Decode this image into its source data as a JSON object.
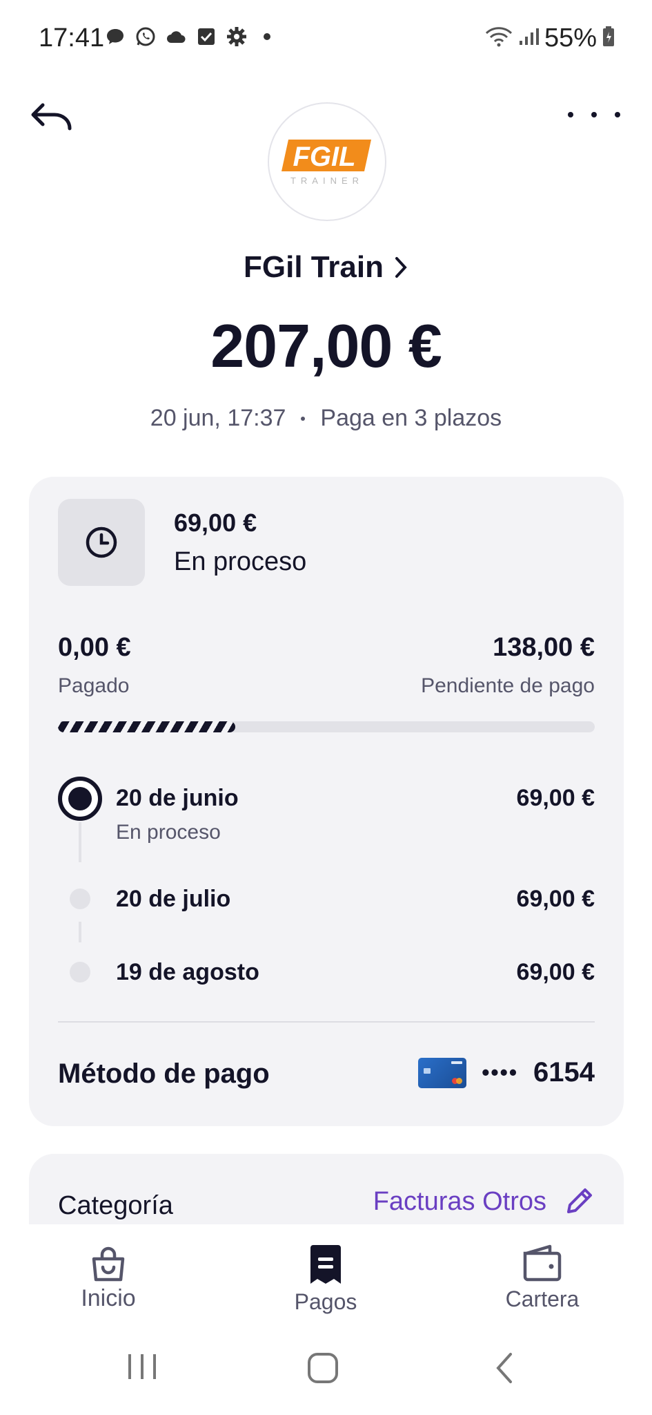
{
  "status_bar": {
    "time": "17:41",
    "battery": "55%",
    "left_icons": [
      "chat-bubble-icon",
      "whatsapp-icon",
      "cloud-icon",
      "checkbox-icon",
      "settings-gear-icon",
      "dot-icon"
    ],
    "right_icons": [
      "wifi-icon",
      "signal-icon",
      "battery-icon"
    ]
  },
  "header": {
    "merchant_logo_text": "FGIL",
    "merchant_logo_subtext": "TRAINER",
    "merchant_name": "FGil Train",
    "amount": "207,00 €",
    "date": "20 jun, 17:37",
    "plan": "Paga en 3 plazos"
  },
  "installment_card": {
    "current_amount": "69,00 €",
    "current_status": "En proceso",
    "paid_amount": "0,00 €",
    "paid_label": "Pagado",
    "pending_amount": "138,00 €",
    "pending_label": "Pendiente de pago",
    "progress_fraction": 0.33,
    "schedule": [
      {
        "date": "20 de junio",
        "status": "En proceso",
        "amount": "69,00 €",
        "active": true
      },
      {
        "date": "20 de julio",
        "status": "",
        "amount": "69,00 €",
        "active": false
      },
      {
        "date": "19 de agosto",
        "status": "",
        "amount": "69,00 €",
        "active": false
      }
    ],
    "payment_method_label": "Método de pago",
    "card_masked": "••••",
    "card_last4": "6154"
  },
  "category": {
    "label": "Categoría",
    "value": "Facturas Otros"
  },
  "bottom_nav": {
    "items": [
      {
        "label": "Inicio",
        "icon": "shopping-bag-icon"
      },
      {
        "label": "Pagos",
        "icon": "receipt-icon"
      },
      {
        "label": "Cartera",
        "icon": "wallet-icon"
      }
    ],
    "active": "Pagos"
  },
  "colors": {
    "text_primary": "#141428",
    "text_secondary": "#55556a",
    "card_bg": "#f3f3f6",
    "accent_purple": "#6a3fc2",
    "logo_orange": "#f28c1b"
  }
}
